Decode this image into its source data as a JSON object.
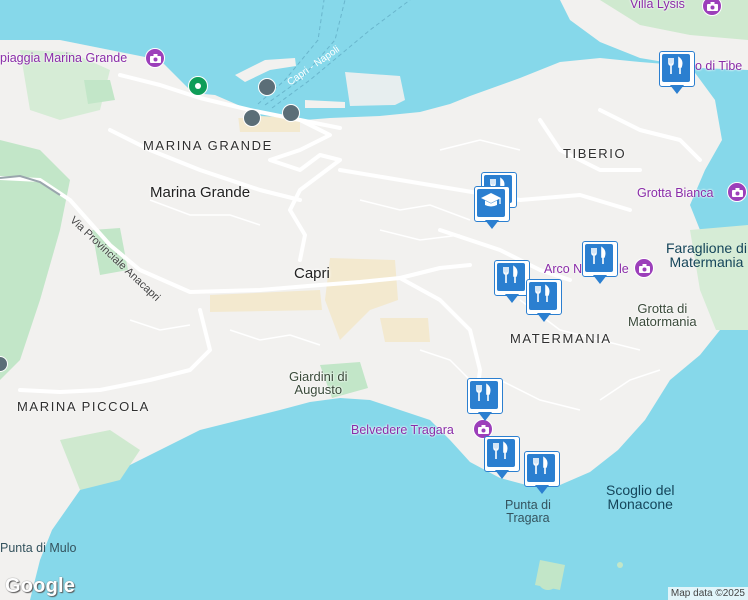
{
  "map": {
    "colors": {
      "sea": "#86d8ea",
      "land": "#f2f1ef",
      "green": "#c2e6c8",
      "road": "#ffffff",
      "pin": "#2b7fd0",
      "poi": "#9c3fba"
    },
    "labels": {
      "marina_grande_district": "MARINA GRANDE",
      "tiberio": "TIBERIO",
      "matermania": "MATERMANIA",
      "marina_piccola": "MARINA PICCOLA",
      "marina_grande_town": "Marina Grande",
      "capri": "Capri",
      "giardini_line1": "Giardini di",
      "giardini_line2": "Augusto",
      "grotta_matermania_line1": "Grotta di",
      "grotta_matermania_line2": "Matormania",
      "faraglione_line1": "Faraglione di",
      "faraglione_line2": "Matermania",
      "scoglio_line1": "Scoglio del",
      "scoglio_line2": "Monacone",
      "punta_tragara_line1": "Punta di",
      "punta_tragara_line2": "Tragara",
      "punta_mulo": "Punta di Mulo",
      "via_provinciale": "Via Provinciale Anacapri",
      "ferry_route": "Capri - Napoli"
    },
    "pois": {
      "spiaggia": "piaggia Marina Grande",
      "villa_lysis": "Villa Lysis",
      "bagni_tiberio": "o di Tibe",
      "grotta_bianca": "Grotta Bianca",
      "arco_naturale": "Arco N",
      "arco_naturale_tail": "le",
      "belvedere": "Belvedere Tragara"
    },
    "icons": {
      "restaurant": "fork-knife-icon",
      "school": "graduation-cap-icon",
      "poi": "camera-icon",
      "ferry": "ferry-icon",
      "transit": "transit-stop-icon"
    },
    "branding": {
      "logo": "Google",
      "attribution": "Map data ©2025"
    }
  }
}
